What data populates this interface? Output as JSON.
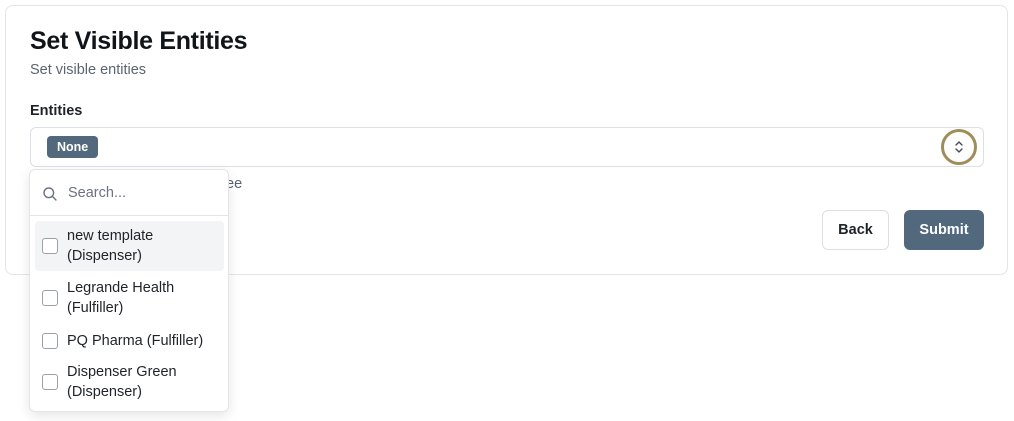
{
  "form": {
    "title": "Set Visible Entities",
    "subtitle": "Set visible entities",
    "entities_label": "Entities",
    "selected_chip": "None",
    "help_text": "ee",
    "back_label": "Back",
    "submit_label": "Submit"
  },
  "dropdown": {
    "search_placeholder": "Search...",
    "options": [
      {
        "line1": "new template",
        "line2": "(Dispenser)"
      },
      {
        "line1": "Legrande Health",
        "line2": "(Fulfiller)"
      },
      {
        "line1": "PQ Pharma (Fulfiller)"
      },
      {
        "line1": "Dispenser Green",
        "line2": "(Dispenser)"
      }
    ]
  },
  "icons": {
    "select_toggle": "chevron-up-down-icon",
    "search": "search-icon"
  },
  "colors": {
    "primary": "#52687d",
    "focus_ring": "#a08e5a",
    "border": "#dcdfe3"
  }
}
